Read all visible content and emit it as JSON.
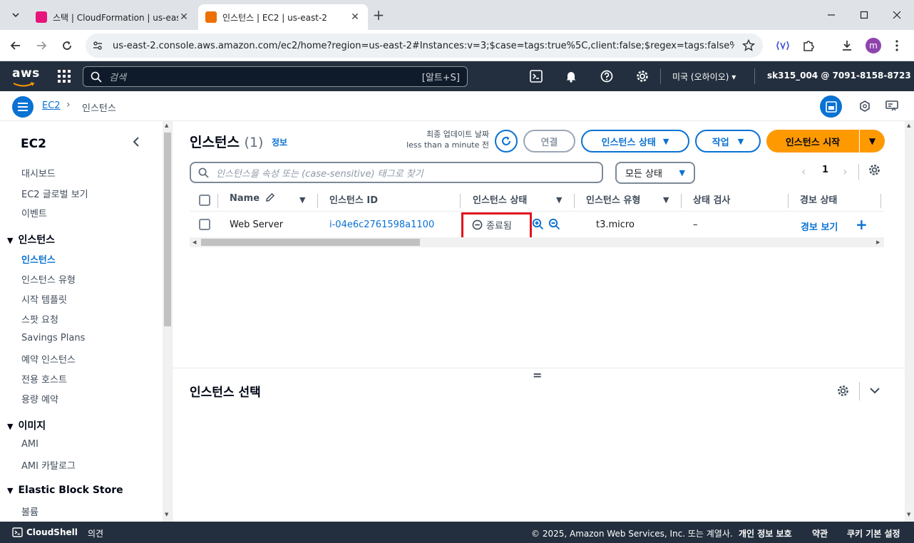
{
  "browser": {
    "tabs": [
      {
        "title": "스택 | CloudFormation | us-eas",
        "favicon_color": "#e7157b",
        "active": false
      },
      {
        "title": "인스턴스 | EC2 | us-east-2",
        "favicon_color": "#ed7100",
        "active": true
      }
    ],
    "url": "us-east-2.console.aws.amazon.com/ec2/home?region=us-east-2#Instances:v=3;$case=tags:true%5C,client:false;$regex=tags:false%5C,cli...",
    "profile_initial": "m"
  },
  "aws_header": {
    "logo": "aws",
    "search_placeholder": "검색",
    "search_shortcut": "[알트+S]",
    "region": "미국 (오하이오)",
    "account": "sk315_004 @ 7091-8158-8723"
  },
  "breadcrumb": {
    "service": "EC2",
    "current": "인스턴스"
  },
  "sidebar": {
    "title": "EC2",
    "top_items": [
      "대시보드",
      "EC2 글로벌 보기",
      "이벤트"
    ],
    "sections": [
      {
        "label": "인스턴스",
        "items": [
          "인스턴스",
          "인스턴스 유형",
          "시작 템플릿",
          "스팟 요청",
          "Savings Plans",
          "예약 인스턴스",
          "전용 호스트",
          "용량 예약"
        ]
      },
      {
        "label": "이미지",
        "items": [
          "AMI",
          "AMI 카탈로그"
        ]
      },
      {
        "label": "Elastic Block Store",
        "items": [
          "볼륨"
        ]
      }
    ]
  },
  "main": {
    "title": "인스턴스",
    "count": "(1)",
    "info": "정보",
    "last_updated_label": "최종 업데이트 날짜",
    "last_updated_value": "less than a minute 전",
    "connect": "연결",
    "instance_state_btn": "인스턴스 상태",
    "actions_btn": "작업",
    "launch_btn": "인스턴스 시작",
    "filter_placeholder": "인스턴스을 속성 또는 (case-sensitive) 태그로 찾기",
    "state_filter": "모든 상태",
    "page": "1",
    "columns": [
      "Name",
      "인스턴스 ID",
      "인스턴스 상태",
      "인스턴스 유형",
      "상태 검사",
      "경보 상태"
    ],
    "rows": [
      {
        "name": "Web Server",
        "id": "i-04e6c2761598a1100",
        "state": "종료됨",
        "type": "t3.micro",
        "check": "–",
        "alarm": "경보 보기"
      }
    ],
    "splitter": "=",
    "detail_title": "인스턴스 선택"
  },
  "footer": {
    "cloudshell": "CloudShell",
    "feedback": "의견",
    "copyright": "© 2025, Amazon Web Services, Inc. 또는 계열사.",
    "privacy": "개인 정보 보호",
    "terms": "약관",
    "cookies": "쿠키 기본 설정"
  },
  "colors": {
    "aws_dark": "#232f3e",
    "link": "#0972d3",
    "primary_orange": "#ff9900",
    "highlight_red": "#e0141e"
  }
}
